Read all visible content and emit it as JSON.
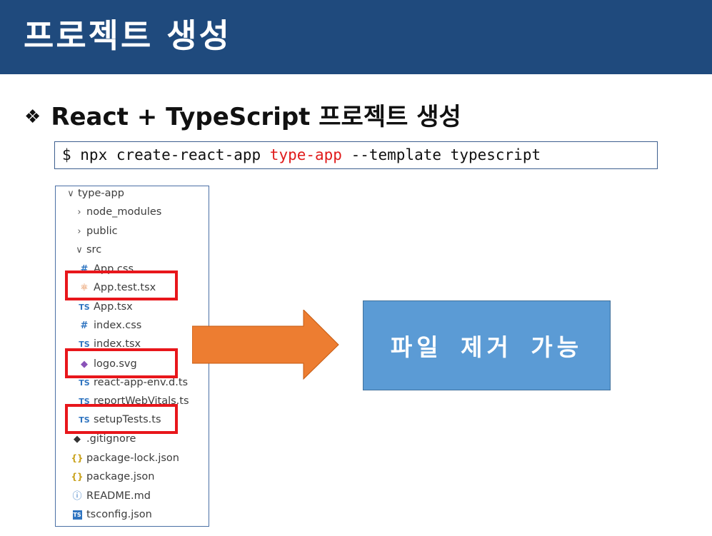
{
  "header": {
    "title": "프로젝트 생성"
  },
  "subtitle": {
    "bullet": "❖",
    "text": "React + TypeScript 프로젝트 생성"
  },
  "command": {
    "prefix": "$ npx create-react-app ",
    "highlight": "type-app",
    "suffix": " --template typescript"
  },
  "explorer": {
    "items": [
      {
        "label": "type-app",
        "chevron": "∨",
        "icon": ""
      },
      {
        "label": "node_modules",
        "chevron": "›",
        "icon": ""
      },
      {
        "label": "public",
        "chevron": "›",
        "icon": ""
      },
      {
        "label": "src",
        "chevron": "∨",
        "icon": ""
      },
      {
        "label": "App.css",
        "icon": "#"
      },
      {
        "label": "App.test.tsx",
        "icon": "⚛"
      },
      {
        "label": "App.tsx",
        "icon": "TS"
      },
      {
        "label": "index.css",
        "icon": "#"
      },
      {
        "label": "index.tsx",
        "icon": "TS"
      },
      {
        "label": "logo.svg",
        "icon": "◆"
      },
      {
        "label": "react-app-env.d.ts",
        "icon": "TS"
      },
      {
        "label": "reportWebVitals.ts",
        "icon": "TS"
      },
      {
        "label": "setupTests.ts",
        "icon": "TS"
      },
      {
        "label": ".gitignore",
        "icon": "◆"
      },
      {
        "label": "package-lock.json",
        "icon": "{}"
      },
      {
        "label": "package.json",
        "icon": "{}"
      },
      {
        "label": "README.md",
        "icon": "ⓘ"
      },
      {
        "label": "tsconfig.json",
        "icon": "TS"
      }
    ]
  },
  "result": {
    "text": "파일 제거 가능"
  },
  "colors": {
    "header_bg": "#1f4a7d",
    "highlight_red": "#e01b1b",
    "arrow": "#ed7d31",
    "result_bg": "#5b9bd5"
  }
}
